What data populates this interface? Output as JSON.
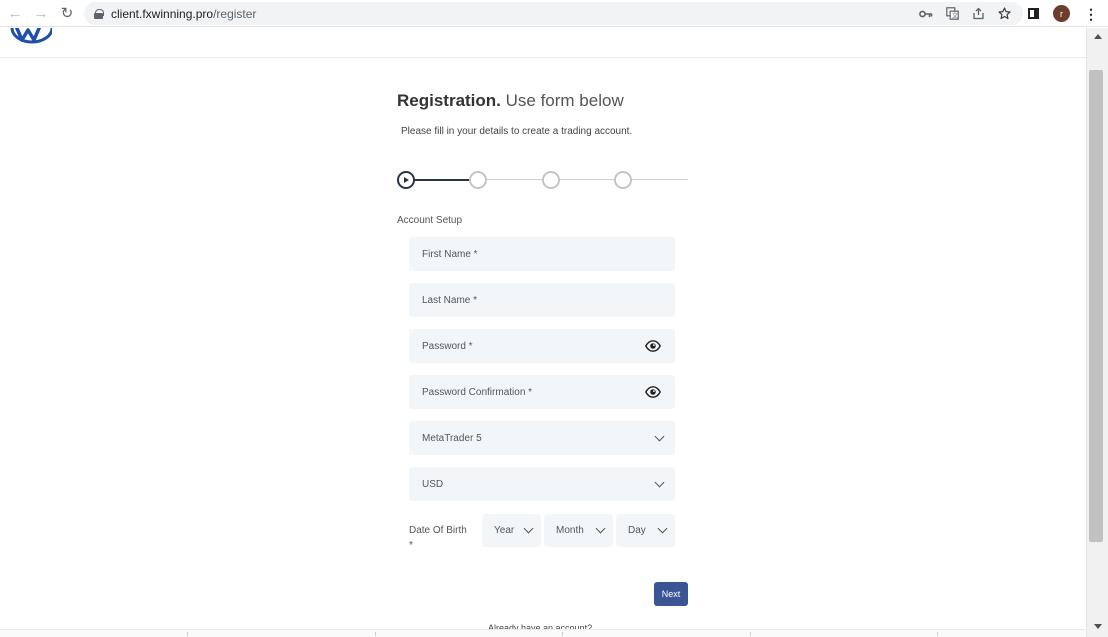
{
  "browser": {
    "url_host": "client.fxwinning.pro",
    "url_path": "/register",
    "profile_initial": "r",
    "icons": [
      "back-icon",
      "forward-icon",
      "reload-icon",
      "lock-icon",
      "key-icon",
      "translate-icon",
      "share-icon",
      "star-icon",
      "side-panel-icon",
      "menu-icon"
    ]
  },
  "page": {
    "title_bold": "Registration.",
    "title_rest": " Use form below",
    "subtitle": "Please fill in your details to create a trading account.",
    "section_label": "Account Setup",
    "stepper": {
      "total_steps": 4,
      "current_step": 1
    }
  },
  "form": {
    "first_name_placeholder": "First Name  *",
    "last_name_placeholder": "Last Name  *",
    "password_placeholder": "Password  *",
    "password_confirmation_placeholder": "Password Confirmation  *",
    "platform_value": "MetaTrader 5",
    "currency_value": "USD",
    "dob_label": "Date Of Birth",
    "dob_required": "*",
    "dob_year": "Year",
    "dob_month": "Month",
    "dob_day": "Day",
    "next_label": "Next",
    "login_hint": "Already have an account?"
  },
  "colors": {
    "accent": "#3a5494",
    "stepper_active": "#2b3446",
    "field_bg": "#f3f6f9"
  }
}
